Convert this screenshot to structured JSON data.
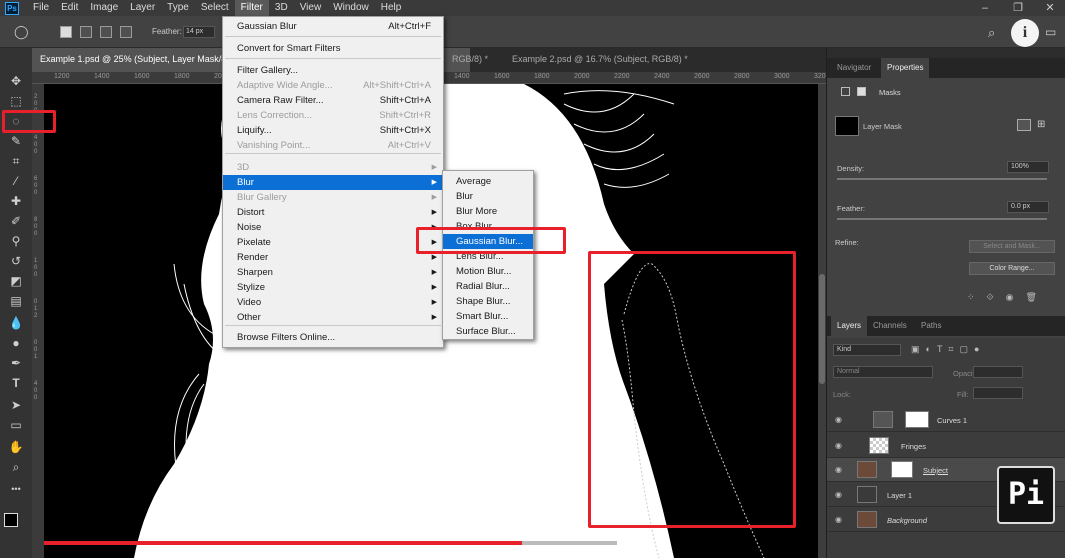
{
  "menubar": {
    "logo": "Ps",
    "items": [
      "File",
      "Edit",
      "Image",
      "Layer",
      "Type",
      "Select",
      "Filter",
      "3D",
      "View",
      "Window",
      "Help"
    ],
    "active": "Filter"
  },
  "options": {
    "feather_label": "Feather:",
    "feather_value": "14 px"
  },
  "tabs": [
    {
      "label": "Example 1.psd @ 25% (Subject, Layer Mask/8) *"
    },
    {
      "label": "RGB/8) *"
    },
    {
      "label": "Example 2.psd @ 16.7% (Subject, RGB/8) *"
    }
  ],
  "ruler": {
    "h": [
      "1200",
      "1400",
      "1600",
      "1800",
      "200",
      "400",
      "600",
      "800",
      "1000",
      "1200",
      "1400",
      "1600",
      "1800",
      "2000",
      "2200",
      "2400",
      "2600",
      "2800",
      "3000",
      "3200"
    ],
    "v": [
      "2",
      "0",
      "0",
      "4",
      "0",
      "0",
      "6",
      "0",
      "0",
      "8",
      "0",
      "0",
      "1",
      "0",
      "0",
      "0",
      "1",
      "2",
      "0",
      "0",
      "1",
      "4",
      "0",
      "0"
    ]
  },
  "filter_menu": {
    "items": [
      {
        "label": "Gaussian Blur",
        "shortcut": "Alt+Ctrl+F"
      },
      {
        "label": "Convert for Smart Filters"
      },
      {
        "label": "Filter Gallery..."
      },
      {
        "label": "Adaptive Wide Angle...",
        "shortcut": "Alt+Shift+Ctrl+A",
        "disabled": true
      },
      {
        "label": "Camera Raw Filter...",
        "shortcut": "Shift+Ctrl+A"
      },
      {
        "label": "Lens Correction...",
        "shortcut": "Shift+Ctrl+R",
        "disabled": true
      },
      {
        "label": "Liquify...",
        "shortcut": "Shift+Ctrl+X"
      },
      {
        "label": "Vanishing Point...",
        "shortcut": "Alt+Ctrl+V",
        "disabled": true
      },
      {
        "label": "3D",
        "disabled": true,
        "submenu": true
      },
      {
        "label": "Blur",
        "submenu": true,
        "highlight": true
      },
      {
        "label": "Blur Gallery",
        "disabled": true,
        "submenu": true
      },
      {
        "label": "Distort",
        "submenu": true
      },
      {
        "label": "Noise",
        "submenu": true
      },
      {
        "label": "Pixelate",
        "submenu": true
      },
      {
        "label": "Render",
        "submenu": true
      },
      {
        "label": "Sharpen",
        "submenu": true
      },
      {
        "label": "Stylize",
        "submenu": true
      },
      {
        "label": "Video",
        "submenu": true
      },
      {
        "label": "Other",
        "submenu": true
      },
      {
        "label": "Browse Filters Online..."
      }
    ]
  },
  "blur_menu": {
    "items": [
      "Average",
      "Blur",
      "Blur More",
      "Box Blur...",
      "Gaussian Blur...",
      "Lens Blur...",
      "Motion Blur...",
      "Radial Blur...",
      "Shape Blur...",
      "Smart Blur...",
      "Surface Blur..."
    ],
    "highlight": "Gaussian Blur..."
  },
  "panels": {
    "top_tabs": [
      "Navigator",
      "Properties"
    ],
    "masks_label": "Masks",
    "layer_mask_label": "Layer Mask",
    "density_label": "Density:",
    "density_value": "100%",
    "feather_label": "Feather:",
    "feather_value": "0.0 px",
    "refine_label": "Refine:",
    "select_mask_btn": "Select and Mask...",
    "color_range_btn": "Color Range...",
    "layer_tabs": [
      "Layers",
      "Channels",
      "Paths"
    ],
    "kind_label": "Kind",
    "blend_mode": "Normal",
    "opacity_label": "Opacity:",
    "lock_label": "Lock:",
    "fill_label": "Fill:",
    "layers": [
      {
        "name": "Curves 1"
      },
      {
        "name": "Fringes"
      },
      {
        "name": "Subject"
      },
      {
        "name": "Layer 1"
      },
      {
        "name": "Background"
      }
    ]
  }
}
